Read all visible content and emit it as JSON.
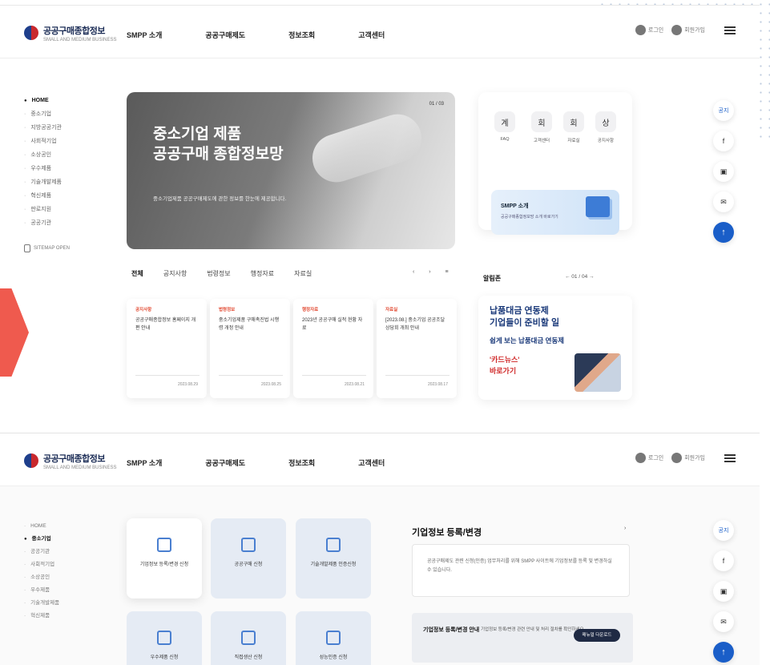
{
  "header": {
    "logo_text": "공공구매종합정보",
    "logo_sub": "SMALL AND MEDIUM BUSINESS",
    "menu": [
      "SMPP 소개",
      "공공구매제도",
      "정보조회",
      "고객센터"
    ],
    "login_label": "로그인",
    "join_label": "회원가입"
  },
  "lnb": {
    "items": [
      {
        "label": "HOME",
        "active": true
      },
      {
        "label": "중소기업"
      },
      {
        "label": "지방공공기관"
      },
      {
        "label": "사회적기업"
      },
      {
        "label": "소상공인"
      },
      {
        "label": "우수제품"
      },
      {
        "label": "기술개발제품"
      },
      {
        "label": "혁신제품"
      },
      {
        "label": "판로지원"
      },
      {
        "label": "공공기관"
      }
    ],
    "sitemap_label": "SITEMAP OPEN"
  },
  "hero": {
    "title_line1": "중소기업 제품",
    "title_line2": "공공구매 종합정보망",
    "desc": "중소기업제품 공공구매제도에 관한 정보를 한눈에 제공합니다.",
    "controls": "01 / 03"
  },
  "quick": {
    "items": [
      {
        "icon": "계",
        "label": "FAQ"
      },
      {
        "icon": "회",
        "label": "고객센터"
      },
      {
        "icon": "회",
        "label": "자료실"
      },
      {
        "icon": "상",
        "label": "공지사항"
      }
    ],
    "smpp_title": "SMPP 소개",
    "smpp_desc": "공공구매종합정보망 소개 바로가기"
  },
  "tabs": {
    "items": [
      "전체",
      "공지사항",
      "법령정보",
      "행정자료",
      "자료실"
    ],
    "nav": "‹ › ≡"
  },
  "cards": [
    {
      "category": "공지사항",
      "title": "공공구매종합정보 홈페이지 개편 안내",
      "date": "2023.08.29"
    },
    {
      "category": "법령정보",
      "title": "중소기업제품 구매촉진법 시행령 개정 안내",
      "date": "2023.08.25"
    },
    {
      "category": "행정자료",
      "title": "2023년 공공구매 실적 현황 자료",
      "date": "2023.08.21"
    },
    {
      "category": "자료실",
      "title": "[2023.08.] 중소기업 공공조달 상담회 개최 안내",
      "date": "2023.08.17"
    }
  ],
  "report": {
    "heading": "알림존",
    "nav": "← 01 / 04 →"
  },
  "banner": {
    "line1": "납품대금 연동제",
    "line2": "기업들이 준비할 일",
    "line3": "쉽게 보는 납품대금 연동제",
    "cta1": "'카드뉴스'",
    "cta2": "바로가기"
  },
  "side_tools": {
    "notice": "공지",
    "share": "f",
    "blog": "▣",
    "mail": "✉",
    "top": "↑"
  },
  "lnb2": {
    "items": [
      {
        "label": "HOME"
      },
      {
        "label": "중소기업",
        "active": true
      },
      {
        "label": "공공기관"
      },
      {
        "label": "사회적기업"
      },
      {
        "label": "소상공인"
      },
      {
        "label": "우수제품"
      },
      {
        "label": "기술개발제품"
      },
      {
        "label": "혁신제품"
      }
    ]
  },
  "services": [
    {
      "label": "기업정보 등록/변경 신청",
      "white": true
    },
    {
      "label": "공공구매 신청",
      "white": false
    },
    {
      "label": "기술개발제품 인증신청",
      "white": false
    },
    {
      "label": "우수제품 신청",
      "white": false
    },
    {
      "label": "직접생산 신청",
      "white": false
    },
    {
      "label": "성능인증 신청",
      "white": false
    }
  ],
  "info": {
    "title": "기업정보 등록/변경",
    "go": "›",
    "desc": "공공구매제도 관련 신청(인증) 업무처리를 위해 SMPP 사이트에 기업정보를 등록 및 변경하실 수 있습니다.",
    "bar_title": "기업정보 등록/변경 안내",
    "bar_desc": "기업정보 등록/변경 관련 안내 및 처리 절차를 확인하세요",
    "bar_btn": "매뉴얼 다운로드"
  }
}
